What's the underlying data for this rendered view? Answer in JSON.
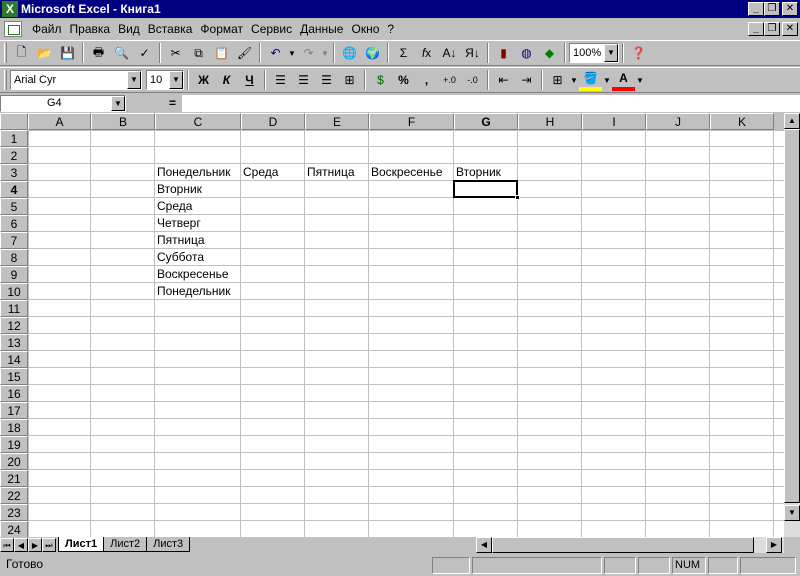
{
  "window": {
    "title": "Microsoft Excel - Книга1",
    "app_icon": "excel-icon",
    "min_glyph": "_",
    "max_glyph": "❐",
    "close_glyph": "✕"
  },
  "menu": [
    "Файл",
    "Правка",
    "Вид",
    "Вставка",
    "Формат",
    "Сервис",
    "Данные",
    "Окно",
    "?"
  ],
  "toolbar_standard": {
    "zoom": "100%"
  },
  "toolbar_format": {
    "font": "Arial Cyr",
    "size": "10",
    "bold": "Ж",
    "italic": "К",
    "underline": "Ч",
    "percent": "%",
    "comma": ","
  },
  "formula_bar": {
    "cell_ref": "G4",
    "eq": "=",
    "content": ""
  },
  "columns": [
    "A",
    "B",
    "C",
    "D",
    "E",
    "F",
    "G",
    "H",
    "I",
    "J",
    "K"
  ],
  "active_column": "G",
  "rows": [
    "1",
    "2",
    "3",
    "4",
    "5",
    "6",
    "7",
    "8",
    "9",
    "10",
    "11",
    "12",
    "13",
    "14",
    "15",
    "16",
    "17",
    "18",
    "19",
    "20",
    "21",
    "22",
    "23",
    "24"
  ],
  "active_row": "4",
  "cells": {
    "C3": "Понедельник",
    "D3": "Среда",
    "E3": "Пятница",
    "F3": "Воскресенье",
    "G3": "Вторник",
    "C4": "Вторник",
    "C5": "Среда",
    "C6": "Четверг",
    "C7": "Пятница",
    "C8": "Суббота",
    "C9": "Воскресенье",
    "C10": "Понедельник"
  },
  "active_cell": "G4",
  "sheet_tabs": [
    "Лист1",
    "Лист2",
    "Лист3"
  ],
  "active_sheet": "Лист1",
  "status": {
    "text": "Готово",
    "num": "NUM"
  }
}
